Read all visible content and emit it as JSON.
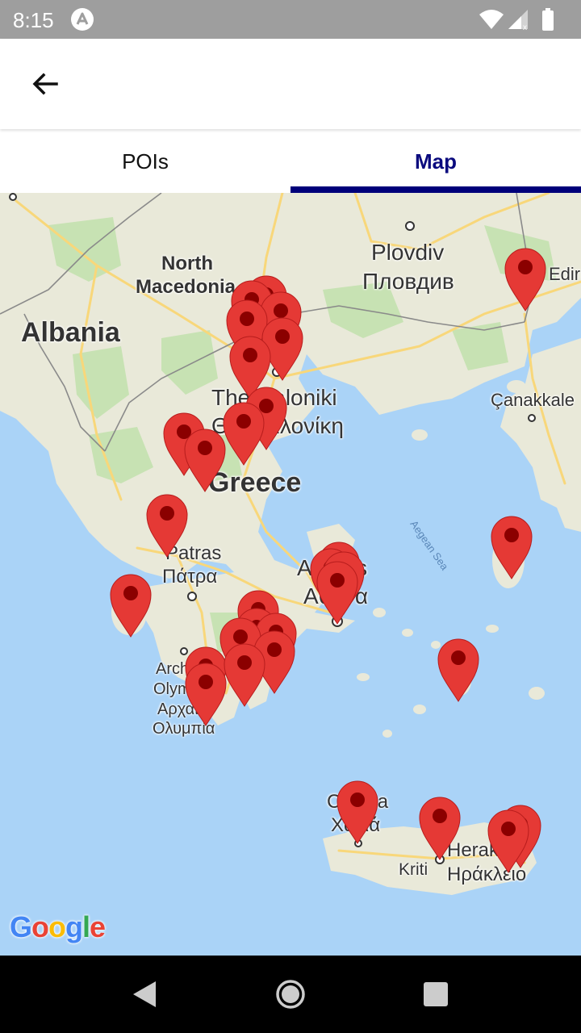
{
  "status_bar": {
    "time": "8:15"
  },
  "tabs": [
    {
      "label": "POIs"
    },
    {
      "label": "Map"
    }
  ],
  "map": {
    "labels": {
      "north_macedonia_1": "North",
      "north_macedonia_2": "Macedonia",
      "albania": "Albania",
      "plovdiv": "Plovdiv",
      "plovdiv_local": "Пловдив",
      "edirne": "Edirı",
      "thessaloniki": "Thessaloniki",
      "thessaloniki_local": "Θεσσαλονίκη",
      "canakkale": "Çanakkale",
      "greece": "Greece",
      "aegean_sea": "Aegean Sea",
      "patras": "Patras",
      "patras_local": "Πάτρα",
      "athens": "Athens",
      "athens_local": "Αθήνα",
      "olympia_1": "Archaia",
      "olympia_2": "Olympia",
      "olympia_local_1": "Αρχαία",
      "olympia_local_2": "Ολυμπία",
      "chania": "Chania",
      "chania_local": "Χανιά",
      "heraklion": "Heraklion",
      "heraklion_local": "Ηράκλειο",
      "kriti": "Kriti"
    },
    "google_logo": "Google",
    "marker_color": "#e53935"
  }
}
